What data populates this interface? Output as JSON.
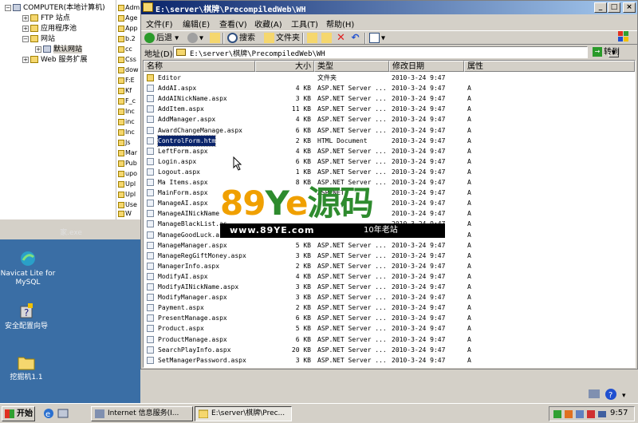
{
  "iis_tree": {
    "items": [
      {
        "label": "COMPUTER(本地计算机)",
        "expander": "−"
      },
      {
        "label": "FTP 站点",
        "expander": "+"
      },
      {
        "label": "应用程序池",
        "expander": "+"
      },
      {
        "label": "网站",
        "expander": "−"
      },
      {
        "label": "默认网站",
        "expander": "+"
      },
      {
        "label": "Web 服务扩展",
        "expander": "+"
      }
    ],
    "strip_items": [
      "Adm",
      "Age",
      "App",
      "b.2",
      "cc",
      "Css",
      "dow",
      "F:E",
      "Kf",
      "F_c",
      "Inc",
      "inc",
      "Inc",
      "Js",
      "Mar",
      "Pub",
      "upo",
      "Upl",
      "Upl",
      "Use",
      "W"
    ]
  },
  "background_window": {
    "title": "家.exe"
  },
  "desktop_icons": [
    {
      "label": "Navicat Lite for MySQL",
      "icon": "navicat-icon"
    },
    {
      "label": "安全配置向导",
      "icon": "security-wizard-icon"
    },
    {
      "label": "挖掘机1.1",
      "icon": "folder-icon"
    }
  ],
  "explorer": {
    "title": "E:\\server\\棋牌\\PrecompiledWeb\\WH",
    "menu": [
      "文件(F)",
      "编辑(E)",
      "查看(V)",
      "收藏(A)",
      "工具(T)",
      "帮助(H)"
    ],
    "toolbar": {
      "back": "后退",
      "search": "搜索",
      "folders": "文件夹"
    },
    "address_label": "地址(D)",
    "address_value": "E:\\server\\棋牌\\PrecompiledWeb\\WH",
    "go_label": "转到",
    "columns": {
      "name": "名称",
      "size": "大小",
      "type": "类型",
      "date": "修改日期",
      "attr": "属性"
    },
    "files": [
      {
        "name": "Editor",
        "size": "",
        "type": "文件夹",
        "date": "2010-3-24 9:47",
        "attr": "",
        "folder": true
      },
      {
        "name": "AddAI.aspx",
        "size": "4 KB",
        "type": "ASP.NET Server ...",
        "date": "2010-3-24 9:47",
        "attr": "A"
      },
      {
        "name": "AddAINickName.aspx",
        "size": "3 KB",
        "type": "ASP.NET Server ...",
        "date": "2010-3-24 9:47",
        "attr": "A"
      },
      {
        "name": "AddItem.aspx",
        "size": "11 KB",
        "type": "ASP.NET Server ...",
        "date": "2010-3-24 9:47",
        "attr": "A"
      },
      {
        "name": "AddManager.aspx",
        "size": "4 KB",
        "type": "ASP.NET Server ...",
        "date": "2010-3-24 9:47",
        "attr": "A"
      },
      {
        "name": "AwardChangeManage.aspx",
        "size": "6 KB",
        "type": "ASP.NET Server ...",
        "date": "2010-3-24 9:47",
        "attr": "A"
      },
      {
        "name": "ControlForm.htm",
        "size": "2 KB",
        "type": "HTML Document",
        "date": "2010-3-24 9:47",
        "attr": "A",
        "selected": true
      },
      {
        "name": "LeftForm.aspx",
        "size": "4 KB",
        "type": "ASP.NET Server ...",
        "date": "2010-3-24 9:47",
        "attr": "A"
      },
      {
        "name": "Login.aspx",
        "size": "6 KB",
        "type": "ASP.NET Server ...",
        "date": "2010-3-24 9:47",
        "attr": "A"
      },
      {
        "name": "Logout.aspx",
        "size": "1 KB",
        "type": "ASP.NET Server ...",
        "date": "2010-3-24 9:47",
        "attr": "A"
      },
      {
        "name": "Ma Items.aspx",
        "size": "8 KB",
        "type": "ASP.NET Server ...",
        "date": "2010-3-24 9:47",
        "attr": "A"
      },
      {
        "name": "MainForm.aspx",
        "size": "",
        "type": "ASP.NET",
        "date": "2010-3-24 9:47",
        "attr": "A"
      },
      {
        "name": "ManageAI.aspx",
        "size": "",
        "type": "",
        "date": "2010-3-24 9:47",
        "attr": "A"
      },
      {
        "name": "ManageAINickName",
        "size": "",
        "type": "",
        "date": "2010-3-24 9:47",
        "attr": "A"
      },
      {
        "name": "ManageBlackList.as",
        "size": "",
        "type": "",
        "date": "2010-3-24 9:47",
        "attr": "A"
      },
      {
        "name": "ManageGoodLuck.as",
        "size": "",
        "type": "",
        "date": "2010-3-24 9:47",
        "attr": "A"
      },
      {
        "name": "ManageManager.aspx",
        "size": "5 KB",
        "type": "ASP.NET Server ...",
        "date": "2010-3-24 9:47",
        "attr": "A"
      },
      {
        "name": "ManageRegGiftMoney.aspx",
        "size": "3 KB",
        "type": "ASP.NET Server ...",
        "date": "2010-3-24 9:47",
        "attr": "A"
      },
      {
        "name": "ManagerInfo.aspx",
        "size": "2 KB",
        "type": "ASP.NET Server ...",
        "date": "2010-3-24 9:47",
        "attr": "A"
      },
      {
        "name": "ModifyAI.aspx",
        "size": "4 KB",
        "type": "ASP.NET Server ...",
        "date": "2010-3-24 9:47",
        "attr": "A"
      },
      {
        "name": "ModifyAINickName.aspx",
        "size": "3 KB",
        "type": "ASP.NET Server ...",
        "date": "2010-3-24 9:47",
        "attr": "A"
      },
      {
        "name": "ModifyManager.aspx",
        "size": "3 KB",
        "type": "ASP.NET Server ...",
        "date": "2010-3-24 9:47",
        "attr": "A"
      },
      {
        "name": "Payment.aspx",
        "size": "2 KB",
        "type": "ASP.NET Server ...",
        "date": "2010-3-24 9:47",
        "attr": "A"
      },
      {
        "name": "PresentManage.aspx",
        "size": "6 KB",
        "type": "ASP.NET Server ...",
        "date": "2010-3-24 9:47",
        "attr": "A"
      },
      {
        "name": "Product.aspx",
        "size": "5 KB",
        "type": "ASP.NET Server ...",
        "date": "2010-3-24 9:47",
        "attr": "A"
      },
      {
        "name": "ProductManage.aspx",
        "size": "6 KB",
        "type": "ASP.NET Server ...",
        "date": "2010-3-24 9:47",
        "attr": "A"
      },
      {
        "name": "SearchPlayInfo.aspx",
        "size": "20 KB",
        "type": "ASP.NET Server ...",
        "date": "2010-3-24 9:47",
        "attr": "A"
      },
      {
        "name": "SetManagerPassword.aspx",
        "size": "3 KB",
        "type": "ASP.NET Server ...",
        "date": "2010-3-24 9:47",
        "attr": "A"
      }
    ]
  },
  "watermark": {
    "big_digits": "89",
    "big_y": "Y",
    "big_e": "e",
    "big_cn": "源码",
    "url": "www.89YE.com",
    "slogan": "10年老站"
  },
  "taskbar": {
    "start_label": "开始",
    "tasks": [
      {
        "label": "Internet 信息服务(I...",
        "active": false
      },
      {
        "label": "E:\\server\\棋牌\\Prec...",
        "active": true
      }
    ],
    "clock": "9:57"
  },
  "colors": {
    "desktop": "#3a6ea5",
    "titlebar_start": "#0a246a",
    "titlebar_end": "#a6caf0",
    "selection": "#0a246a",
    "watermark_orange": "#f0a000",
    "watermark_green": "#2e8b2e"
  }
}
